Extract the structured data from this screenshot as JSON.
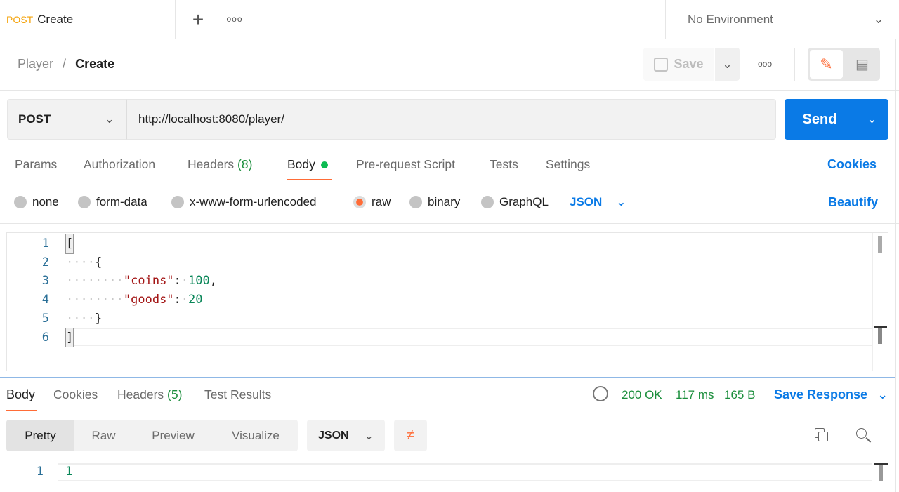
{
  "tab": {
    "method": "POST",
    "name": "Create"
  },
  "environment": "No Environment",
  "breadcrumb": {
    "parent": "Player",
    "current": "Create"
  },
  "toolbar": {
    "save_label": "Save"
  },
  "request": {
    "method": "POST",
    "url": "http://localhost:8080/player/",
    "send_label": "Send"
  },
  "req_tabs": {
    "params": "Params",
    "authorization": "Authorization",
    "headers": "Headers",
    "headers_count": "(8)",
    "body": "Body",
    "prerequest": "Pre-request Script",
    "tests": "Tests",
    "settings": "Settings",
    "cookies": "Cookies"
  },
  "body_options": {
    "none": "none",
    "form_data": "form-data",
    "urlencoded": "x-www-form-urlencoded",
    "raw": "raw",
    "binary": "binary",
    "graphql": "GraphQL",
    "language": "JSON",
    "beautify": "Beautify",
    "selected": "raw"
  },
  "editor": {
    "line_numbers": [
      "1",
      "2",
      "3",
      "4",
      "5",
      "6"
    ],
    "open_bracket": "[",
    "open_brace": "{",
    "coins_key": "\"coins\"",
    "coins_value": "100",
    "goods_key": "\"goods\"",
    "goods_value": "20",
    "close_brace": "}",
    "close_bracket": "]"
  },
  "response": {
    "tabs": {
      "body": "Body",
      "cookies": "Cookies",
      "headers": "Headers",
      "headers_count": "(5)",
      "test_results": "Test Results"
    },
    "status": "200 OK",
    "time": "117 ms",
    "size": "165 B",
    "save_response": "Save Response",
    "views": [
      "Pretty",
      "Raw",
      "Preview",
      "Visualize"
    ],
    "format": "JSON",
    "line_number": "1",
    "content": "1"
  },
  "colors": {
    "accent": "#0a7ae6",
    "post": "#f4a30b",
    "success": "#1b8e3c",
    "brand_orange": "#ff6c37"
  }
}
